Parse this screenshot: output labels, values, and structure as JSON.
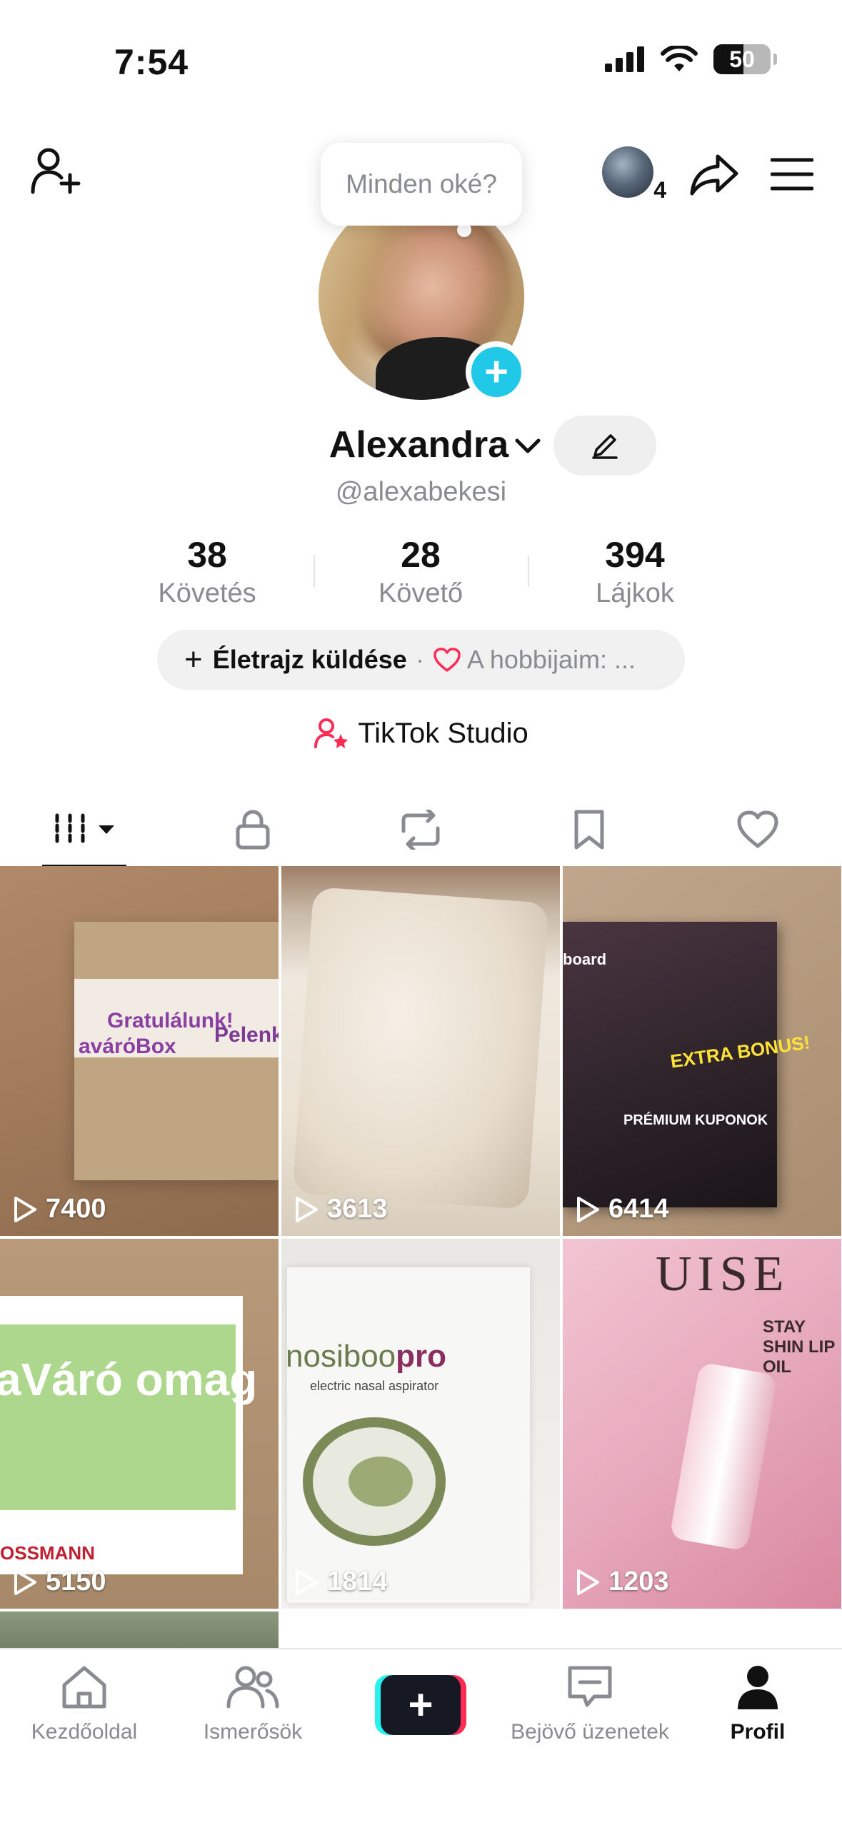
{
  "status_bar": {
    "time": "7:54",
    "battery": "50"
  },
  "header": {
    "avatar_badge_count": "4"
  },
  "bubble": {
    "text": "Minden oké?"
  },
  "profile": {
    "name": "Alexandra",
    "username": "@alexabekesi"
  },
  "stats": [
    {
      "value": "38",
      "label": "Követés"
    },
    {
      "value": "28",
      "label": "Követő"
    },
    {
      "value": "394",
      "label": "Lájkok"
    }
  ],
  "bio": {
    "action": "Életrajz küldése",
    "separator": "·",
    "hobby_text": "A hobbijaim: ..."
  },
  "studio": {
    "label": "TikTok Studio"
  },
  "tabs": [
    {
      "icon": "grid-icon",
      "active": true
    },
    {
      "icon": "lock-icon"
    },
    {
      "icon": "repost-icon"
    },
    {
      "icon": "bookmark-icon"
    },
    {
      "icon": "heart-icon"
    }
  ],
  "videos": [
    {
      "views": "7400",
      "text_a": "Gratulálunk!",
      "text_b": "avárόBox",
      "text_c": "Pelenk"
    },
    {
      "views": "3613"
    },
    {
      "views": "6414",
      "text_a": "board",
      "text_b": "EXTRA BONUS!",
      "text_c": "PRÉMIUM KUPONOK"
    },
    {
      "views": "5150",
      "text_a": "aVáró omag",
      "text_b": "OSSMANN"
    },
    {
      "views": "1814",
      "text_a": "nosiboo",
      "text_b": "pro",
      "text_c": "electric nasal aspirator"
    },
    {
      "views": "1203",
      "text_a": "UISE",
      "text_b": "STAY SHIN LIP OIL"
    }
  ],
  "bottom_nav": [
    {
      "label": "Kezdőoldal"
    },
    {
      "label": "Ismerősök"
    },
    {
      "label": ""
    },
    {
      "label": "Bejövő üzenetek"
    },
    {
      "label": "Profil"
    }
  ],
  "colors": {
    "accent_cyan": "#20c9e8",
    "tiktok_pink": "#fe2c55",
    "tiktok_teal": "#25f4ee",
    "muted_text": "#8a8b91"
  }
}
